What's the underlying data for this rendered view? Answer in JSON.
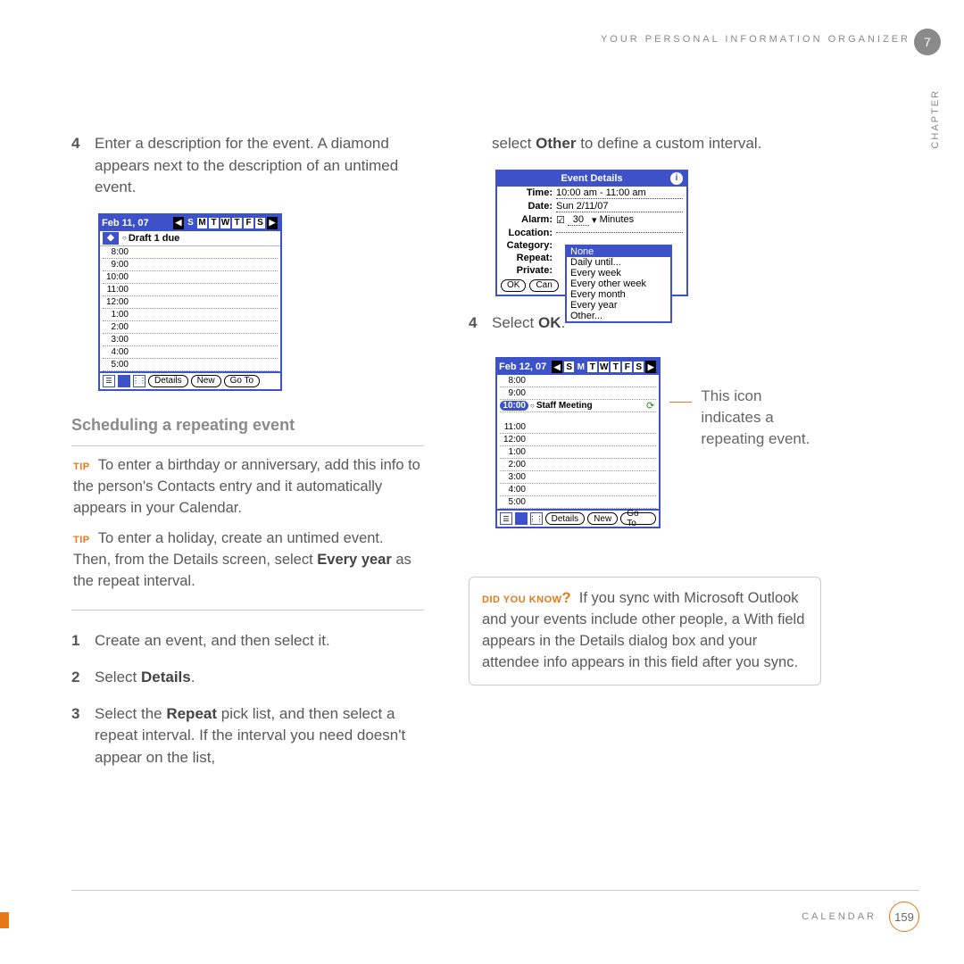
{
  "header": {
    "title": "YOUR PERSONAL INFORMATION ORGANIZER",
    "chapter_num": "7",
    "chapter_label": "CHAPTER"
  },
  "left": {
    "step4": {
      "num": "4",
      "text_a": "Enter a description for the event. A diamond appears next to the description of an untimed event."
    },
    "cal1": {
      "date": "Feb 11, 07",
      "days": [
        "S",
        "M",
        "T",
        "W",
        "T",
        "F",
        "S"
      ],
      "sel_day": 0,
      "draft": "Draft 1 due",
      "times": [
        "8:00",
        "9:00",
        "10:00",
        "11:00",
        "12:00",
        "1:00",
        "2:00",
        "3:00",
        "4:00",
        "5:00"
      ],
      "buttons": {
        "details": "Details",
        "new": "New",
        "goto": "Go To"
      }
    },
    "heading": "Scheduling a repeating event",
    "tip1": {
      "label": "TIP",
      "text": "To enter a birthday or anniversary, add this info to the person's Contacts entry and it automatically appears in your Calendar."
    },
    "tip2": {
      "label": "TIP",
      "text_a": "To enter a holiday, create an untimed event. Then, from the Details screen, select ",
      "bold": "Every year",
      "text_b": " as the repeat interval."
    },
    "step1": {
      "num": "1",
      "text": "Create an event, and then select it."
    },
    "step2": {
      "num": "2",
      "text_a": "Select ",
      "bold": "Details",
      "text_b": "."
    },
    "step3": {
      "num": "3",
      "text_a": "Select the ",
      "bold": "Repeat",
      "text_b": " pick list, and then select a repeat interval. If the interval you need doesn't appear on the list,"
    }
  },
  "right": {
    "cont": {
      "text_a": "select ",
      "bold": "Other",
      "text_b": " to define a custom interval."
    },
    "ed": {
      "title": "Event Details",
      "rows": {
        "time_l": "Time:",
        "time_v": "10:00 am - 11:00 am",
        "date_l": "Date:",
        "date_v": "Sun 2/11/07",
        "alarm_l": "Alarm:",
        "alarm_v": "30",
        "alarm_u": "Minutes",
        "loc_l": "Location:",
        "cat_l": "Category:",
        "rep_l": "Repeat:",
        "priv_l": "Private:"
      },
      "popup": [
        "None",
        "Daily until...",
        "Every week",
        "Every other week",
        "Every month",
        "Every year",
        "Other..."
      ],
      "ok": "OK",
      "cancel": "Can"
    },
    "step4": {
      "num": "4",
      "text_a": "Select ",
      "bold": "OK",
      "text_b": "."
    },
    "cal2": {
      "date": "Feb 12, 07",
      "days": [
        "S",
        "M",
        "T",
        "W",
        "T",
        "F",
        "S"
      ],
      "sel_day": 1,
      "times": [
        "8:00",
        "9:00",
        "10:00",
        "11:00",
        "12:00",
        "1:00",
        "2:00",
        "3:00",
        "4:00",
        "5:00"
      ],
      "event_time": "10:00",
      "event_name": "Staff Meeting",
      "buttons": {
        "details": "Details",
        "new": "New",
        "goto": "Go To"
      }
    },
    "callout": "This icon indicates a repeating event.",
    "dyk": {
      "label": "DID YOU KNOW",
      "q": "?",
      "text": "If you sync with Microsoft Outlook and your events include other people, a With field appears in the Details dialog box and your attendee info appears in this field after you sync."
    }
  },
  "footer": {
    "section": "CALENDAR",
    "page": "159"
  }
}
